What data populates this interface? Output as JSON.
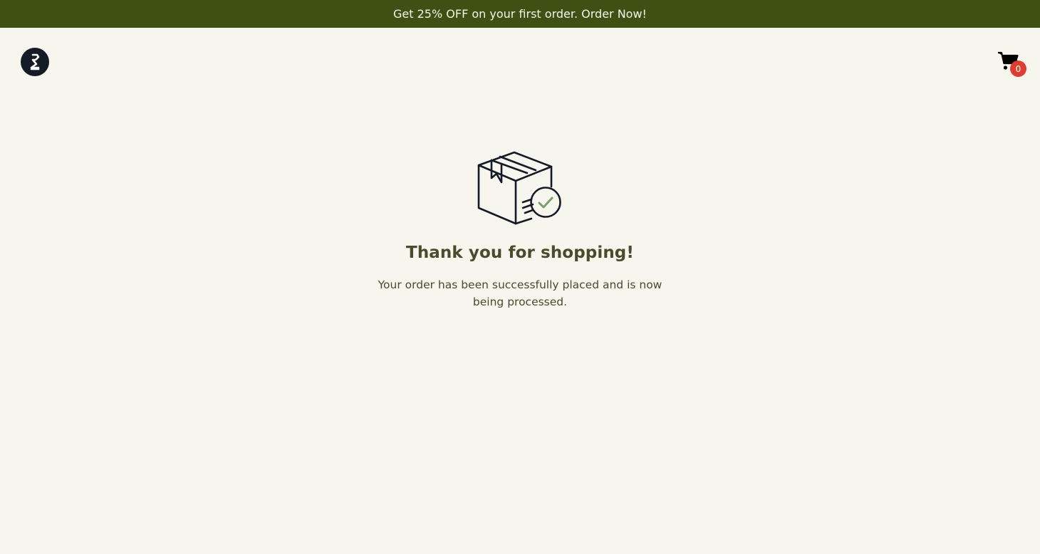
{
  "promo": {
    "text": "Get 25% OFF on your first order. Order Now!"
  },
  "header": {
    "logo_icon": "brand-logo-icon",
    "cart": {
      "icon": "shopping-cart-icon",
      "count": "0"
    }
  },
  "confirmation": {
    "icon": "package-check-icon",
    "title": "Thank you for shopping!",
    "message": "Your order has been successfully placed and is now being processed."
  },
  "colors": {
    "promo_background": "#3f5015",
    "page_background": "#f6f5ee",
    "heading_text": "#4a4a2c",
    "badge": "#dc3f2f",
    "check_accent": "#7aa06a"
  }
}
